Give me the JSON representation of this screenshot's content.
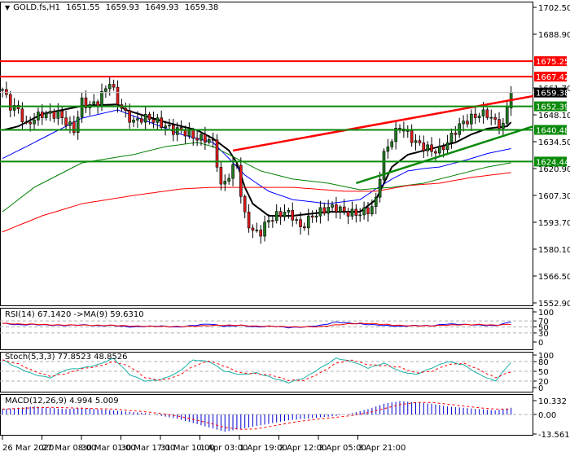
{
  "header": {
    "symbol": "GOLD.fs,H1",
    "open": "1651.55",
    "high": "1659.93",
    "low": "1649.93",
    "close": "1659.38"
  },
  "colors": {
    "bull": "#1f7a1f",
    "bear": "#e31b1b",
    "support": "#0a8a0a",
    "resistance": "#ff0000",
    "ma_fast": "#000000",
    "ma_blue": "#0000ff",
    "ma_green": "#008000",
    "ma_red": "#ff0000",
    "stoch_main": "#20b2aa",
    "signal": "#ff0000",
    "macd_hist": "#0000cc"
  },
  "chart_data": [
    {
      "type": "candlestick",
      "title": "GOLD.fs,H1",
      "ylim": [
        1552.9,
        1702.5
      ],
      "y_ticks": [
        "1702.50",
        "1688.90",
        "1661.70",
        "1648.10",
        "1634.50",
        "1620.90",
        "1607.30",
        "1593.70",
        "1580.10",
        "1566.50",
        "1552.90"
      ],
      "x_ticks": [
        "26 Mar 2020",
        "27 Mar 08:00",
        "30 Mar 01:00",
        "30 Mar 17:00",
        "31 Mar 10:00",
        "1 Apr 03:00",
        "1 Apr 19:00",
        "2 Apr 12:00",
        "3 Apr 05:00",
        "3 Apr 21:00"
      ],
      "bars": 128,
      "close_path": [
        [
          0,
          1660.9
        ],
        [
          2,
          1652.6
        ],
        [
          4,
          1650.6
        ],
        [
          6,
          1642.3
        ],
        [
          8,
          1646.4
        ],
        [
          10,
          1648.5
        ],
        [
          14,
          1648.5
        ],
        [
          16,
          1644.4
        ],
        [
          18,
          1640.3
        ],
        [
          20,
          1654.7
        ],
        [
          22,
          1652.6
        ],
        [
          24,
          1654.7
        ],
        [
          27,
          1665.0
        ],
        [
          29,
          1654.7
        ],
        [
          31,
          1648.5
        ],
        [
          33,
          1644.4
        ],
        [
          35,
          1646.4
        ],
        [
          37,
          1646.4
        ],
        [
          39,
          1644.4
        ],
        [
          41,
          1642.3
        ],
        [
          43,
          1640.3
        ],
        [
          45,
          1640.3
        ],
        [
          47,
          1638.2
        ],
        [
          49,
          1636.1
        ],
        [
          51,
          1636.1
        ],
        [
          53,
          1634.1
        ],
        [
          54,
          1623.8
        ],
        [
          55,
          1611.4
        ],
        [
          57,
          1617.6
        ],
        [
          59,
          1623.8
        ],
        [
          60,
          1607.3
        ],
        [
          61,
          1597.0
        ],
        [
          63,
          1588.8
        ],
        [
          65,
          1588.8
        ],
        [
          67,
          1595.0
        ],
        [
          69,
          1597.0
        ],
        [
          71,
          1599.0
        ],
        [
          73,
          1597.0
        ],
        [
          75,
          1590.8
        ],
        [
          78,
          1597.0
        ],
        [
          80,
          1599.0
        ],
        [
          82,
          1601.1
        ],
        [
          84,
          1601.1
        ],
        [
          86,
          1599.0
        ],
        [
          88,
          1598.2
        ],
        [
          90,
          1598.2
        ],
        [
          92,
          1599.9
        ],
        [
          93,
          1601.1
        ],
        [
          94,
          1605.2
        ],
        [
          95,
          1617.6
        ],
        [
          96,
          1627.9
        ],
        [
          98,
          1636.1
        ],
        [
          100,
          1642.3
        ],
        [
          102,
          1638.2
        ],
        [
          104,
          1634.1
        ],
        [
          106,
          1632.0
        ],
        [
          108,
          1630.0
        ],
        [
          110,
          1630.0
        ],
        [
          112,
          1634.1
        ],
        [
          114,
          1640.3
        ],
        [
          116,
          1644.4
        ],
        [
          118,
          1646.4
        ],
        [
          120,
          1648.5
        ],
        [
          122,
          1648.5
        ],
        [
          124,
          1644.4
        ],
        [
          126,
          1642.3
        ],
        [
          127,
          1652.0
        ],
        [
          128,
          1659.38
        ]
      ],
      "moving_averages": [
        {
          "name": "ma_fast",
          "points": [
            [
              0,
              1640.3
            ],
            [
              4,
              1642.3
            ],
            [
              10,
              1648.5
            ],
            [
              20,
              1652.6
            ],
            [
              29,
              1653.4
            ],
            [
              31,
              1650.6
            ],
            [
              41,
              1644.4
            ],
            [
              49,
              1640.3
            ],
            [
              53,
              1636.1
            ],
            [
              57,
              1630.0
            ],
            [
              59,
              1623.8
            ],
            [
              61,
              1611.4
            ],
            [
              63,
              1603.1
            ],
            [
              67,
              1597.0
            ],
            [
              73,
              1597.0
            ],
            [
              82,
              1599.0
            ],
            [
              90,
              1599.0
            ],
            [
              94,
              1605.2
            ],
            [
              98,
              1621.7
            ],
            [
              102,
              1627.9
            ],
            [
              106,
              1630.0
            ],
            [
              110,
              1632.0
            ],
            [
              114,
              1634.1
            ],
            [
              118,
              1638.2
            ],
            [
              122,
              1641.1
            ],
            [
              127,
              1642.3
            ],
            [
              128,
              1644.4
            ]
          ]
        },
        {
          "name": "ma_blue",
          "points": [
            [
              0,
              1626.0
            ],
            [
              6,
              1632.0
            ],
            [
              12,
              1638.2
            ],
            [
              20,
              1646.4
            ],
            [
              29,
              1650.6
            ],
            [
              37,
              1644.4
            ],
            [
              45,
              1638.2
            ],
            [
              53,
              1634.1
            ],
            [
              57,
              1626.0
            ],
            [
              61,
              1617.6
            ],
            [
              67,
              1609.4
            ],
            [
              73,
              1605.2
            ],
            [
              82,
              1603.1
            ],
            [
              90,
              1605.2
            ],
            [
              94,
              1610.6
            ],
            [
              98,
              1615.6
            ],
            [
              102,
              1619.7
            ],
            [
              106,
              1620.9
            ],
            [
              110,
              1621.7
            ],
            [
              114,
              1623.8
            ],
            [
              118,
              1626.0
            ],
            [
              122,
              1628.5
            ],
            [
              128,
              1631.0
            ]
          ]
        },
        {
          "name": "ma_green",
          "points": [
            [
              0,
              1599.0
            ],
            [
              8,
              1611.4
            ],
            [
              20,
              1623.8
            ],
            [
              33,
              1628.0
            ],
            [
              41,
              1632.0
            ],
            [
              49,
              1634.1
            ],
            [
              53,
              1632.0
            ],
            [
              57,
              1628.0
            ],
            [
              65,
              1619.7
            ],
            [
              73,
              1615.6
            ],
            [
              82,
              1613.5
            ],
            [
              90,
              1610.2
            ],
            [
              98,
              1611.4
            ],
            [
              106,
              1613.5
            ],
            [
              114,
              1617.6
            ],
            [
              122,
              1621.7
            ],
            [
              128,
              1623.8
            ]
          ]
        },
        {
          "name": "ma_red",
          "points": [
            [
              0,
              1588.8
            ],
            [
              10,
              1597.0
            ],
            [
              20,
              1603.1
            ],
            [
              33,
              1607.3
            ],
            [
              45,
              1610.6
            ],
            [
              53,
              1611.4
            ],
            [
              61,
              1611.4
            ],
            [
              73,
              1611.4
            ],
            [
              86,
              1609.4
            ],
            [
              94,
              1609.4
            ],
            [
              102,
              1612.3
            ],
            [
              110,
              1613.5
            ],
            [
              118,
              1616.4
            ],
            [
              128,
              1618.9
            ]
          ]
        }
      ],
      "levels": [
        {
          "value": 1675.25,
          "label": "1675.25",
          "kind": "resistance"
        },
        {
          "value": 1667.42,
          "label": "1667.42",
          "kind": "resistance"
        },
        {
          "value": 1652.39,
          "label": "1652.39",
          "kind": "support"
        },
        {
          "value": 1640.48,
          "label": "1640.48",
          "kind": "support"
        },
        {
          "value": 1624.44,
          "label": "1624.44",
          "kind": "support"
        }
      ],
      "current_price": {
        "value": 1659.38,
        "label": "1659.38"
      },
      "trendlines": [
        {
          "kind": "resistance",
          "from": [
            58,
            1630.0
          ],
          "to": [
            133,
            1657.6
          ]
        },
        {
          "kind": "support",
          "from": [
            89,
            1613.5
          ],
          "to": [
            133,
            1642.3
          ]
        }
      ]
    },
    {
      "type": "line",
      "title": "RSI(14) 67.1420  ->MA(9) 59.6310",
      "ylim": [
        0,
        100
      ],
      "y_ticks": [
        "100",
        "70",
        "50",
        "30",
        "0"
      ],
      "levels": [
        70,
        50,
        30
      ],
      "rsi": [
        62,
        57,
        58,
        56,
        55,
        57,
        54,
        55,
        50,
        52,
        53,
        49,
        55,
        60,
        52,
        55,
        50,
        53,
        48,
        50,
        55,
        66,
        62,
        58,
        55,
        52,
        55,
        54,
        60,
        58,
        56,
        54,
        67
      ]
    },
    {
      "type": "line",
      "title": "Stoch(5,3,3) 77.8523 48.8526",
      "ylim": [
        0,
        100
      ],
      "y_ticks": [
        "100",
        "80",
        "50",
        "20",
        "0"
      ],
      "levels": [
        80,
        50,
        20
      ],
      "main": [
        85,
        60,
        40,
        30,
        55,
        60,
        70,
        90,
        40,
        20,
        25,
        45,
        85,
        80,
        50,
        40,
        45,
        30,
        15,
        30,
        60,
        90,
        80,
        60,
        75,
        50,
        40,
        60,
        80,
        70,
        40,
        20,
        78
      ]
    },
    {
      "type": "bar",
      "title": "MACD(12,26,9) 4.994 5.009",
      "ylim": [
        -13.561,
        10.332
      ],
      "y_ticks": [
        "10.332",
        "0.00",
        "-13.561"
      ],
      "histogram": [
        4,
        5,
        6,
        5,
        4,
        5,
        4,
        3,
        2,
        1,
        -1,
        -3,
        -6,
        -9,
        -12,
        -10,
        -8,
        -6,
        -4,
        -3,
        -2,
        -1,
        1,
        4,
        8,
        10,
        9,
        8,
        6,
        5,
        4,
        3,
        5
      ]
    }
  ]
}
